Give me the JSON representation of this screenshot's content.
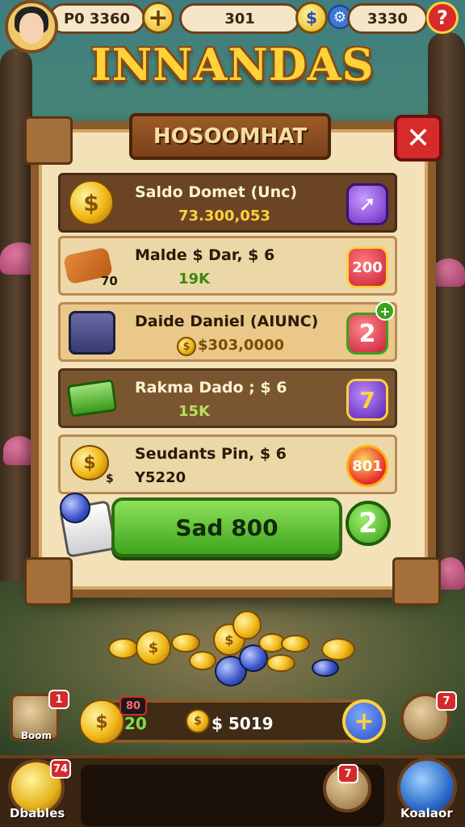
{
  "topbar": {
    "player_value": "P0 3360",
    "center_value": "301",
    "right_value": "3330",
    "plus_icon": "plus-icon",
    "gear_icon": "gear-icon",
    "help_label": "?"
  },
  "title": "INNANDAS",
  "panel": {
    "banner": "HOSOOMHAT",
    "close_label": "✕",
    "rows": [
      {
        "label": "Saldo Domet (Unc)",
        "value": "73.300,053",
        "badge": "➚"
      },
      {
        "label": "Malde $ Dar, $ 6",
        "value": "19K",
        "sub": "70",
        "badge": "200"
      },
      {
        "label": "Daide Daniel (AIUNC)",
        "value": "$303,0000",
        "badge": "2",
        "badge_plus": "+"
      },
      {
        "label": "Rakma Dado ; $ 6",
        "value": "15K",
        "badge": "7"
      },
      {
        "label": "Seudants Pin, $ 6",
        "value": "Y5220",
        "sub": "$",
        "badge": "801"
      }
    ],
    "action_button": "Sad 800",
    "action_count": "2"
  },
  "bottom": {
    "currency_left": "20",
    "currency_left_badge": "80",
    "currency_right": "$ 5019",
    "plus_label": "+",
    "left_item_label": "Boom",
    "left_item_badge": "1",
    "right_item_badge": "7",
    "nav": [
      {
        "label": "Dbables",
        "badge": "74"
      },
      {
        "label": "",
        "badge": "7"
      },
      {
        "label": "Koalaor",
        "badge": ""
      }
    ]
  },
  "colors": {
    "accent": "#ffd23a",
    "panel": "#f3e1b8",
    "wood": "#8b5a2b",
    "green": "#3ea51d",
    "red": "#d62b2b"
  }
}
